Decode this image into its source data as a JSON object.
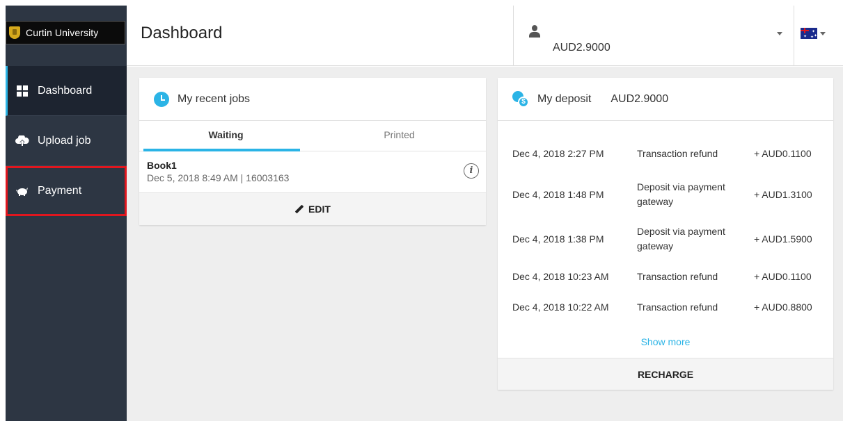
{
  "app": {
    "org_name": "Curtin University"
  },
  "sidebar": {
    "items": [
      {
        "label": "Dashboard",
        "icon": "grid-icon",
        "active": true
      },
      {
        "label": "Upload job",
        "icon": "cloud-upload-icon"
      },
      {
        "label": "Payment",
        "icon": "piggy-bank-icon",
        "highlighted": true
      }
    ]
  },
  "header": {
    "title": "Dashboard",
    "user_balance": "AUD2.9000",
    "flag": "australia-flag-icon"
  },
  "jobs": {
    "title": "My recent jobs",
    "tabs": [
      "Waiting",
      "Printed"
    ],
    "active_tab": "Waiting",
    "items": [
      {
        "name": "Book1",
        "meta": "Dec 5, 2018 8:49 AM | 16003163"
      }
    ],
    "edit_label": "EDIT"
  },
  "deposit": {
    "title": "My deposit",
    "amount": "AUD2.9000",
    "transactions": [
      {
        "date": "Dec 4, 2018 2:27 PM",
        "type": "Transaction refund",
        "amount": "+ AUD0.1100"
      },
      {
        "date": "Dec 4, 2018 1:48 PM",
        "type": "Deposit via payment gateway",
        "amount": "+ AUD1.3100"
      },
      {
        "date": "Dec 4, 2018 1:38 PM",
        "type": "Deposit via payment gateway",
        "amount": "+ AUD1.5900"
      },
      {
        "date": "Dec 4, 2018 10:23 AM",
        "type": "Transaction refund",
        "amount": "+ AUD0.1100"
      },
      {
        "date": "Dec 4, 2018 10:22 AM",
        "type": "Transaction refund",
        "amount": "+ AUD0.8800"
      }
    ],
    "show_more_label": "Show more",
    "recharge_label": "RECHARGE"
  },
  "colors": {
    "accent": "#2bb4e6",
    "sidebar_bg": "#2d3643",
    "highlight": "#e0161e"
  }
}
